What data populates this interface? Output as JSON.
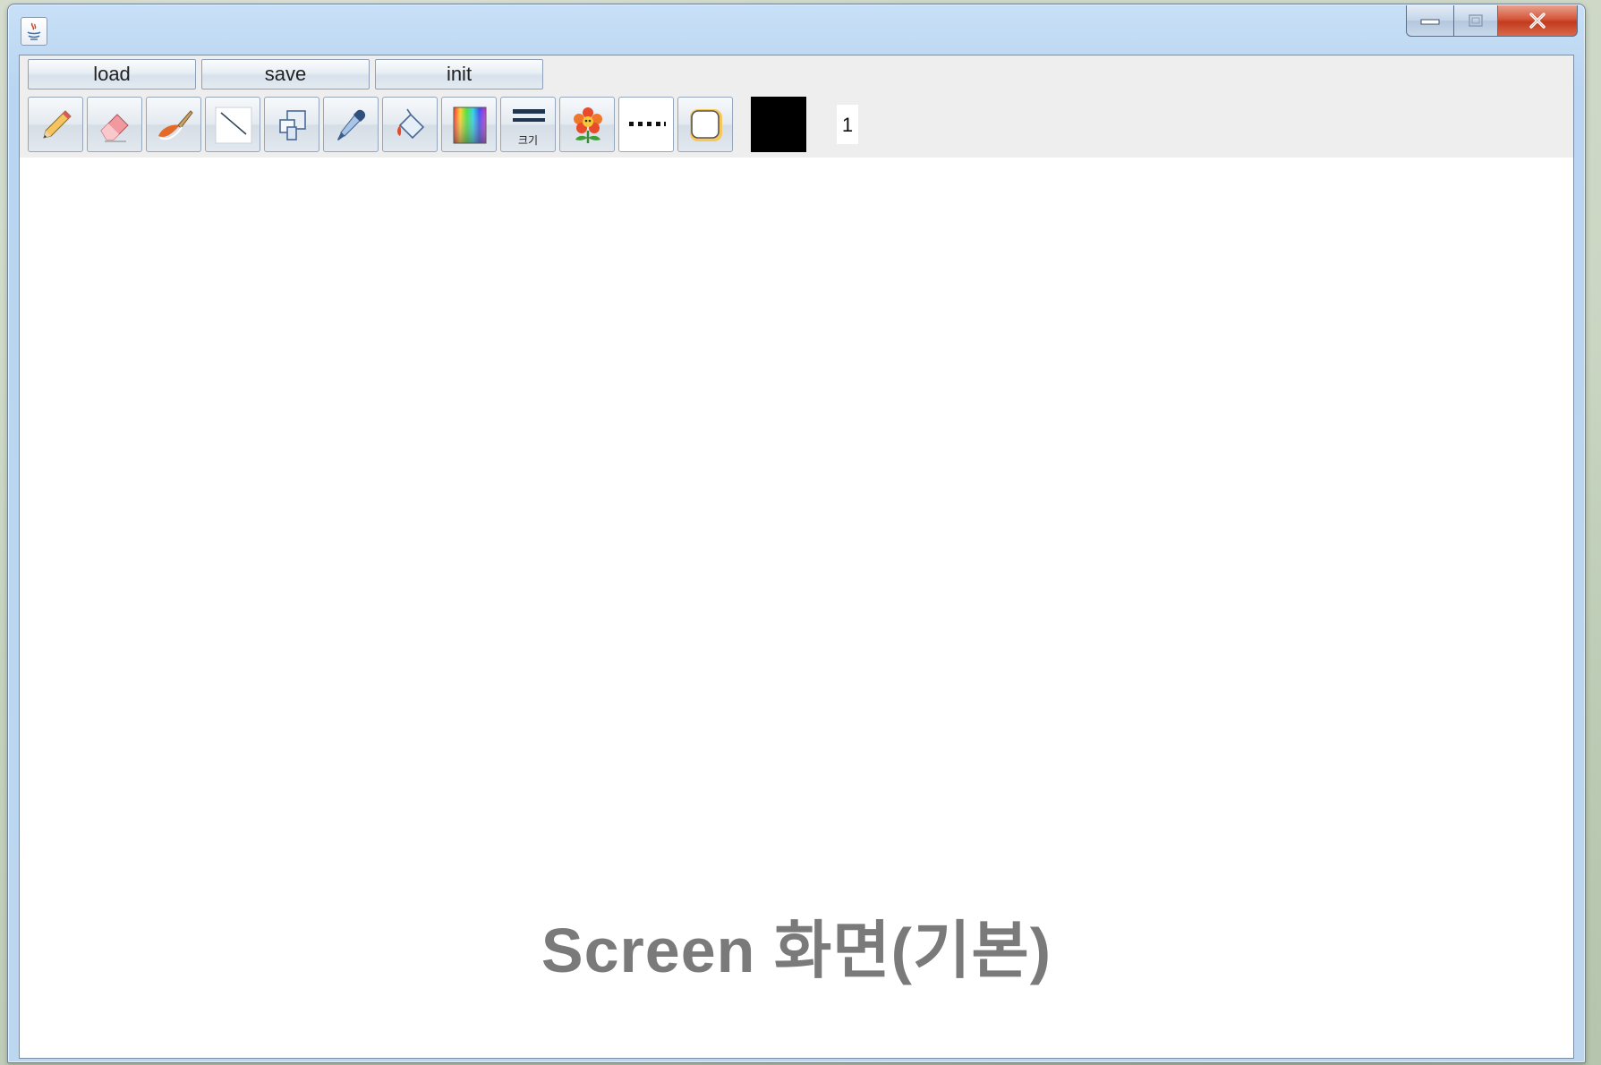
{
  "window": {
    "title": "",
    "controls": {
      "minimize_icon": "minimize-icon",
      "maximize_icon": "maximize-icon",
      "close_icon": "close-icon"
    }
  },
  "buttons": {
    "load": "load",
    "save": "save",
    "init": "init"
  },
  "tools": [
    {
      "name": "pencil-icon"
    },
    {
      "name": "eraser-icon"
    },
    {
      "name": "brush-icon"
    },
    {
      "name": "line-icon"
    },
    {
      "name": "shapes-icon"
    },
    {
      "name": "eyedropper-icon"
    },
    {
      "name": "paint-bucket-icon"
    },
    {
      "name": "color-spectrum-icon"
    },
    {
      "name": "line-thickness-icon",
      "label": "크기"
    },
    {
      "name": "flower-stamp-icon"
    },
    {
      "name": "dotted-line-icon"
    },
    {
      "name": "rounded-rect-icon"
    }
  ],
  "current_color": "#000000",
  "size_value": "1",
  "caption": "Screen 화면(기본)"
}
